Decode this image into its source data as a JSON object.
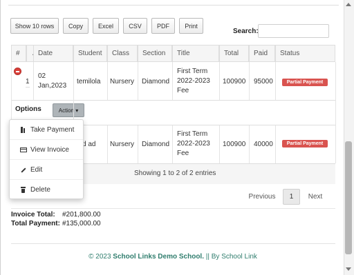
{
  "toolbar": {
    "buttons": [
      "Show 10 rows",
      "Copy",
      "Excel",
      "CSV",
      "PDF",
      "Print"
    ],
    "search_label": "Search:",
    "search_value": ""
  },
  "table": {
    "headers": [
      "#",
      "Date",
      "Student",
      "Class",
      "Section",
      "Title",
      "Total",
      "Paid",
      "Status"
    ],
    "rows": [
      {
        "num": "1",
        "date": "02 Jan,2023",
        "student": "temilola",
        "class": "Nursery",
        "section": "Diamond",
        "title": "First Term 2022-2023 Fee",
        "total": "100900",
        "paid": "95000",
        "status": "Partial Payment"
      },
      {
        "num": "",
        "date": "",
        "student": "d ad",
        "class": "Nursery",
        "section": "Diamond",
        "title": "First Term 2022-2023 Fee",
        "total": "100900",
        "paid": "40000",
        "status": "Partial Payment"
      }
    ],
    "options_label": "Options",
    "action_label": "Action",
    "showing": "Showing 1 to 2 of 2 entries"
  },
  "dropdown": {
    "items": [
      {
        "label": "Take Payment",
        "icon": "receipt-icon"
      },
      {
        "label": "View Invoice",
        "icon": "card-icon"
      },
      {
        "label": "Edit",
        "icon": "pencil-icon"
      },
      {
        "label": "Delete",
        "icon": "trash-icon"
      }
    ]
  },
  "pagination": {
    "previous": "Previous",
    "page": "1",
    "next": "Next"
  },
  "totals": {
    "invoice_label": "Invoice Total:",
    "invoice_value": "#201,800.00",
    "payment_label": "Total Payment:",
    "payment_value": "#135,000.00"
  },
  "footer": {
    "prefix": "© 2023",
    "school": "School Links Demo School.",
    "suffix": "|| By School Link"
  },
  "colors": {
    "badge": "#d9534f",
    "footer_text": "#2f7d6d",
    "action_button": "#aeb4b8"
  }
}
